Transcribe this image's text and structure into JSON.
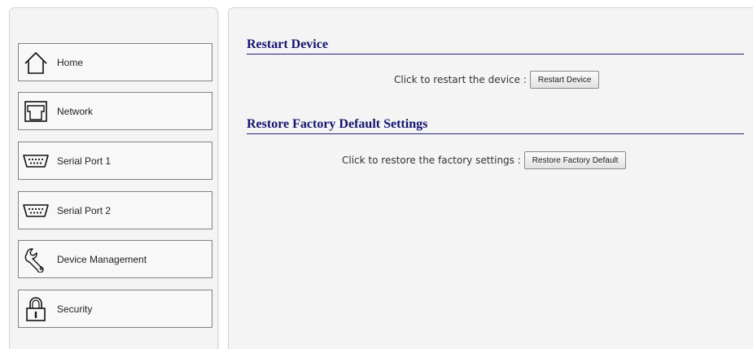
{
  "sidebar": {
    "items": [
      {
        "label": "Home",
        "icon": "home-icon"
      },
      {
        "label": "Network",
        "icon": "network-port-icon"
      },
      {
        "label": "Serial Port 1",
        "icon": "serial-port-icon"
      },
      {
        "label": "Serial Port 2",
        "icon": "serial-port-icon"
      },
      {
        "label": "Device Management",
        "icon": "wrench-icon"
      },
      {
        "label": "Security",
        "icon": "lock-icon"
      }
    ]
  },
  "main": {
    "restart": {
      "title": "Restart Device",
      "prompt": "Click to restart the device :",
      "button_label": "Restart Device"
    },
    "restore": {
      "title": "Restore Factory Default Settings",
      "prompt": "Click to restore the factory settings :",
      "button_label": "Restore Factory Default"
    }
  },
  "colors": {
    "heading": "#14146e",
    "heading_rule": "#23237a",
    "panel_bg": "#f4f4f4",
    "nav_border": "#828282"
  }
}
